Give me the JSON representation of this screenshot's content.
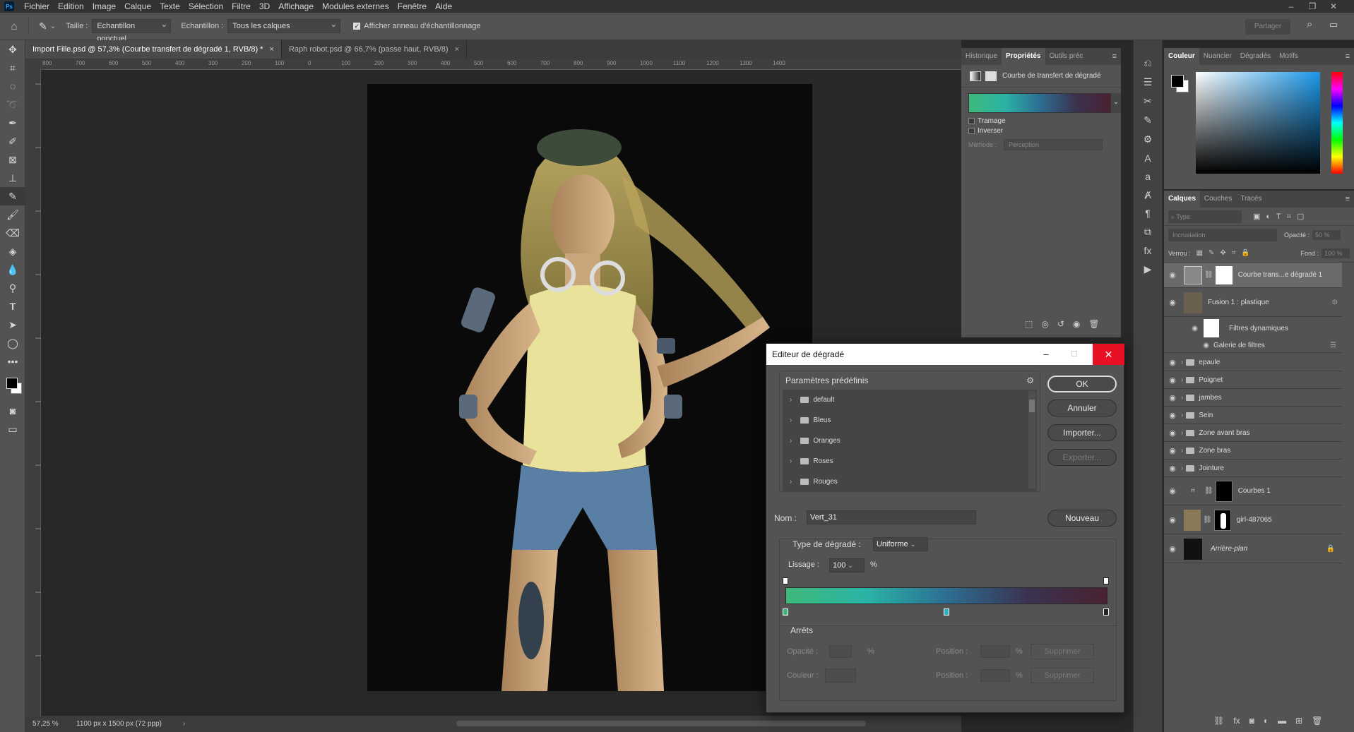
{
  "menubar": {
    "app_icon": "Ps",
    "items": [
      "Fichier",
      "Edition",
      "Image",
      "Calque",
      "Texte",
      "Sélection",
      "Filtre",
      "3D",
      "Affichage",
      "Modules externes",
      "Fenêtre",
      "Aide"
    ]
  },
  "options_bar": {
    "taille_label": "Taille :",
    "taille_value": "Echantillon ponctuel",
    "echantillon_label": "Echantillon :",
    "echantillon_value": "Tous les calques",
    "anneau_label": "Afficher anneau d'échantillonnage",
    "share_label": "Partager"
  },
  "doc_tabs": [
    {
      "label": "Import Fille.psd @ 57,3% (Courbe transfert de dégradé 1, RVB/8) *",
      "close": "×"
    },
    {
      "label": "Raph robot.psd @ 66,7% (passe haut, RVB/8)",
      "close": "×"
    }
  ],
  "ruler_ticks": [
    "800",
    "700",
    "600",
    "500",
    "400",
    "300",
    "200",
    "100",
    "0",
    "100",
    "200",
    "300",
    "400",
    "500",
    "600",
    "700",
    "800",
    "900",
    "1000",
    "1100",
    "1200",
    "1300",
    "1400"
  ],
  "status": {
    "zoom": "57,25 %",
    "doc_size": "1100 px x 1500 px (72 ppp)"
  },
  "properties_panel": {
    "tabs": [
      "Historique",
      "Propriétés",
      "Outils préc"
    ],
    "title": "Courbe de transfert de dégradé",
    "tramage": "Tramage",
    "inverser": "Inverser",
    "methode_label": "Méthode :",
    "methode_value": "Perception"
  },
  "color_panel": {
    "tabs": [
      "Couleur",
      "Nuancier",
      "Dégradés",
      "Motifs"
    ]
  },
  "layers_panel": {
    "tabs": [
      "Calques",
      "Couches",
      "Tracés"
    ],
    "search_placeholder": "Type",
    "blend_mode": "Incrustation",
    "opacity_label": "Opacité :",
    "opacity_value": "50 %",
    "lock_label": "Verrou :",
    "fill_label": "Fond :",
    "fill_value": "100 %",
    "layers": [
      {
        "name": "Courbe trans...e dégradé 1",
        "kind": "adjustment"
      },
      {
        "name": "Fusion 1 : plastique",
        "kind": "smart"
      },
      {
        "name": "Filtres dynamiques",
        "kind": "sub"
      },
      {
        "name": "Galerie de filtres",
        "kind": "sub2"
      },
      {
        "name": "epaule",
        "kind": "group"
      },
      {
        "name": "Poignet",
        "kind": "group"
      },
      {
        "name": "jambes",
        "kind": "group"
      },
      {
        "name": "Sein",
        "kind": "group"
      },
      {
        "name": "Zone avant bras",
        "kind": "group"
      },
      {
        "name": "Zone bras",
        "kind": "group"
      },
      {
        "name": "Jointure",
        "kind": "group"
      },
      {
        "name": "Courbes 1",
        "kind": "curves"
      },
      {
        "name": "girl-487065",
        "kind": "photo"
      },
      {
        "name": "Arrière-plan",
        "kind": "background"
      }
    ]
  },
  "gradient_editor": {
    "title": "Editeur de dégradé",
    "presets_label": "Paramètres prédéfinis",
    "presets": [
      "default",
      "Bleus",
      "Oranges",
      "Roses",
      "Rouges"
    ],
    "ok": "OK",
    "annuler": "Annuler",
    "importer": "Importer...",
    "exporter": "Exporter...",
    "nom_label": "Nom :",
    "nom_value": "Vert_31",
    "nouveau": "Nouveau",
    "type_label": "Type de dégradé :",
    "type_value": "Uniforme",
    "lissage_label": "Lissage :",
    "lissage_value": "100",
    "percent": "%",
    "arrets_label": "Arrêts",
    "opacite_label": "Opacité :",
    "couleur_label": "Couleur :",
    "position_label": "Position :",
    "supprimer": "Supprimer",
    "gradient_colors": [
      "#3fb97a",
      "#2ab3a6",
      "#2d6e92",
      "#3a3350",
      "#4a2131"
    ]
  },
  "colors": {
    "accent_close": "#e81123",
    "foreground": "#000000",
    "background": "#ffffff"
  }
}
